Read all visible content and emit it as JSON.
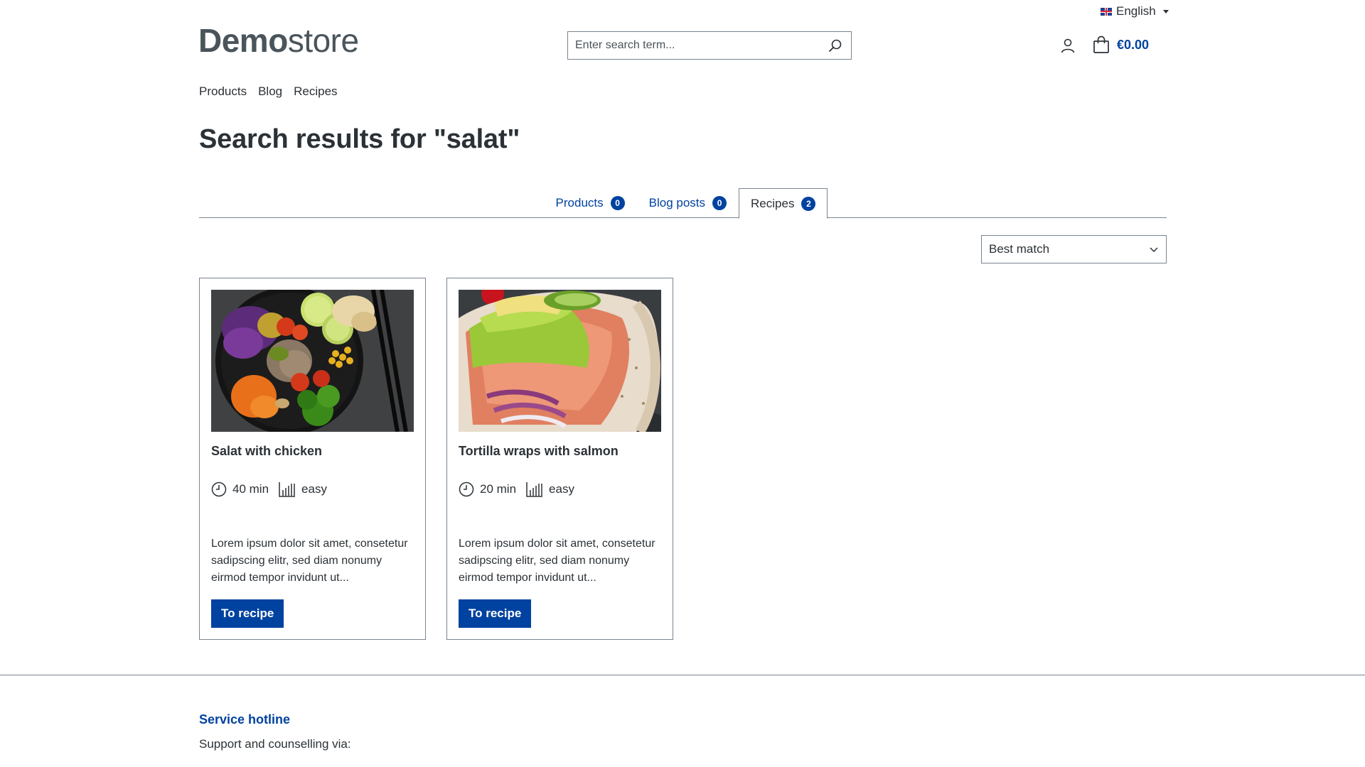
{
  "header": {
    "language": "English",
    "logo_bold": "Demo",
    "logo_light": "store",
    "search_placeholder": "Enter search term...",
    "cart_total": "€0.00"
  },
  "nav": [
    "Products",
    "Blog",
    "Recipes"
  ],
  "page_title": "Search results for \"salat\"",
  "tabs": [
    {
      "label": "Products",
      "count": "0",
      "active": false
    },
    {
      "label": "Blog posts",
      "count": "0",
      "active": false
    },
    {
      "label": "Recipes",
      "count": "2",
      "active": true
    }
  ],
  "sort": {
    "selected": "Best match"
  },
  "recipes": [
    {
      "title": "Salat with chicken",
      "time": "40 min",
      "difficulty": "easy",
      "description": "Lorem ipsum dolor sit amet, consetetur sadipscing elitr, sed diam nonumy eirmod tempor invidunt ut...",
      "button": "To recipe"
    },
    {
      "title": "Tortilla wraps with salmon",
      "time": "20 min",
      "difficulty": "easy",
      "description": "Lorem ipsum dolor sit amet, consetetur sadipscing elitr, sed diam nonumy eirmod tempor invidunt ut...",
      "button": "To recipe"
    }
  ],
  "footer": {
    "hotline_title": "Service hotline",
    "hotline_text": "Support and counselling via:"
  },
  "colors": {
    "primary": "#0042a0",
    "text": "#2b3136",
    "border": "#798490"
  }
}
